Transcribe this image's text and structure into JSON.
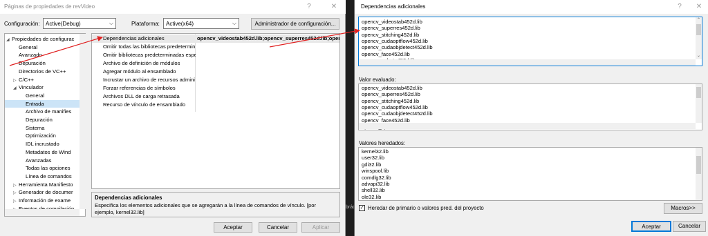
{
  "left_dialog": {
    "title": "Páginas de propiedades de revVideo",
    "help_btn": "?",
    "close_btn": "✕",
    "config_label": "Configuración:",
    "config_value": "Active(Debug)",
    "platform_label": "Plataforma:",
    "platform_value": "Active(x64)",
    "config_manager_btn": "Administrador de configuración...",
    "tree": [
      {
        "label": "Propiedades de configurac",
        "toggle": "◢",
        "indent": 0
      },
      {
        "label": "General",
        "toggle": "",
        "indent": 1
      },
      {
        "label": "Avanzado",
        "toggle": "",
        "indent": 1
      },
      {
        "label": "Depuración",
        "toggle": "",
        "indent": 1
      },
      {
        "label": "Directorios de VC++",
        "toggle": "",
        "indent": 1
      },
      {
        "label": "C/C++",
        "toggle": "▷",
        "indent": 1
      },
      {
        "label": "Vinculador",
        "toggle": "◢",
        "indent": 1
      },
      {
        "label": "General",
        "toggle": "",
        "indent": 2
      },
      {
        "label": "Entrada",
        "toggle": "",
        "indent": 2
      },
      {
        "label": "Archivo de manifies",
        "toggle": "",
        "indent": 2
      },
      {
        "label": "Depuración",
        "toggle": "",
        "indent": 2
      },
      {
        "label": "Sistema",
        "toggle": "",
        "indent": 2
      },
      {
        "label": "Optimización",
        "toggle": "",
        "indent": 2
      },
      {
        "label": "IDL incrustado",
        "toggle": "",
        "indent": 2
      },
      {
        "label": "Metadatos de Wind",
        "toggle": "",
        "indent": 2
      },
      {
        "label": "Avanzadas",
        "toggle": "",
        "indent": 2
      },
      {
        "label": "Todas las opciones",
        "toggle": "",
        "indent": 2
      },
      {
        "label": "Línea de comandos",
        "toggle": "",
        "indent": 2
      },
      {
        "label": "Herramienta Manifiesto",
        "toggle": "▷",
        "indent": 1
      },
      {
        "label": "Generador de documer",
        "toggle": "▷",
        "indent": 1
      },
      {
        "label": "Información de exame",
        "toggle": "▷",
        "indent": 1
      },
      {
        "label": "Eventos de compilación",
        "toggle": "▷",
        "indent": 1
      }
    ],
    "selected_tree_index": 8,
    "grid": [
      {
        "name": "Dependencias adicionales",
        "value": "opencv_videostab452d.lib;opencv_superres452d.lib;opencv"
      },
      {
        "name": "Omitir todas las bibliotecas predetermin",
        "value": ""
      },
      {
        "name": "Omitir bibliotecas predeterminadas espe",
        "value": ""
      },
      {
        "name": "Archivo de definición de módulos",
        "value": ""
      },
      {
        "name": "Agregar módulo al ensamblado",
        "value": ""
      },
      {
        "name": "Incrustar un archivo de recursos admini",
        "value": ""
      },
      {
        "name": "Forzar referencias de símbolos",
        "value": ""
      },
      {
        "name": "Archivos DLL de carga retrasada",
        "value": ""
      },
      {
        "name": "Recurso de vínculo de ensamblado",
        "value": ""
      }
    ],
    "desc_title": "Dependencias adicionales",
    "desc_text": "Especifica los elementos adicionales que se agregarán a la línea de comandos de vínculo. [por ejemplo, kernel32.lib]",
    "ok_btn": "Aceptar",
    "cancel_btn": "Cancelar",
    "apply_btn": "Aplicar"
  },
  "background_strip": "bráctic",
  "right_dialog": {
    "title": "Dependencias adicionales",
    "help_btn": "?",
    "close_btn": "✕",
    "edit_items": [
      "opencv_videostab452d.lib",
      "opencv_superres452d.lib",
      "opencv_stitching452d.lib",
      "opencv_cudaoptflow452d.lib",
      "opencv_cudaobjdetect452d.lib",
      "opencv_face452d.lib",
      "opencv_xphoto452d.lib"
    ],
    "evaluated_label": "Valor evaluado:",
    "evaluated_items": [
      "opencv_videostab452d.lib",
      "opencv_superres452d.lib",
      "opencv_stitching452d.lib",
      "opencv_cudaoptflow452d.lib",
      "opencv_cudaobjdetect452d.lib",
      "opencv_face452d.lib",
      "opencv_xphoto452d.lib"
    ],
    "inherited_label": "Valores heredados:",
    "inherited_items": [
      "kernel32.lib",
      "user32.lib",
      "gdi32.lib",
      "winspool.lib",
      "comdlg32.lib",
      "advapi32.lib",
      "shell32.lib",
      "ole32.lib"
    ],
    "inherit_checkbox": "Heredar de primario o valores pred. del proyecto",
    "inherit_checked": true,
    "macros_btn": "Macros>>",
    "ok_btn": "Aceptar",
    "cancel_btn": "Cancelar"
  },
  "colors": {
    "arrow": "#e02020",
    "selection": "#cce4f7",
    "focus_border": "#0078d7"
  }
}
